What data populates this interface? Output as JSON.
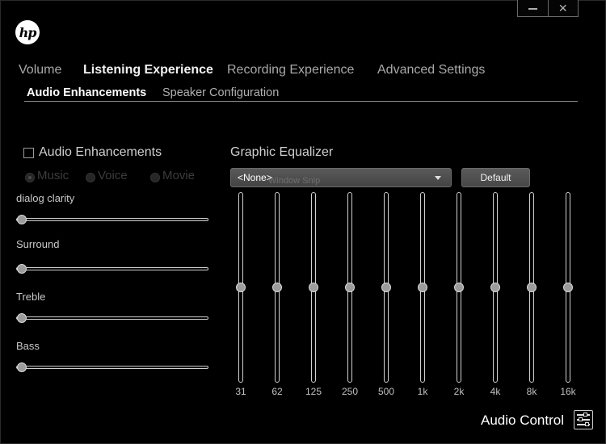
{
  "window": {
    "minimize_glyph": "",
    "close_glyph": "✕"
  },
  "brand": {
    "logo_text": "hp"
  },
  "main_tabs": [
    {
      "label": "Volume",
      "active": false
    },
    {
      "label": "Listening Experience",
      "active": true
    },
    {
      "label": "Recording Experience",
      "active": false
    },
    {
      "label": "Advanced Settings",
      "active": false
    }
  ],
  "sub_tabs": [
    {
      "label": "Audio Enhancements",
      "active": true
    },
    {
      "label": "Speaker Configuration",
      "active": false
    }
  ],
  "enhancements": {
    "checkbox_label": "Audio Enhancements",
    "checked": false,
    "modes": [
      {
        "label": "Music",
        "selected": true,
        "enabled": false
      },
      {
        "label": "Voice",
        "selected": false,
        "enabled": false
      },
      {
        "label": "Movie",
        "selected": false,
        "enabled": false
      }
    ]
  },
  "sliders": [
    {
      "label": "dialog clarity",
      "value_fraction": 0.0
    },
    {
      "label": "Surround",
      "value_fraction": 0.0
    },
    {
      "label": "Treble",
      "value_fraction": 0.0
    },
    {
      "label": "Bass",
      "value_fraction": 0.0
    }
  ],
  "equalizer": {
    "title": "Graphic Equalizer",
    "preset_value": "<None>",
    "overlay_text": "Window Snip",
    "default_button": "Default",
    "bands": [
      {
        "label": "31",
        "value_fraction": 0.5
      },
      {
        "label": "62",
        "value_fraction": 0.5
      },
      {
        "label": "125",
        "value_fraction": 0.5
      },
      {
        "label": "250",
        "value_fraction": 0.5
      },
      {
        "label": "500",
        "value_fraction": 0.5
      },
      {
        "label": "1k",
        "value_fraction": 0.5
      },
      {
        "label": "2k",
        "value_fraction": 0.5
      },
      {
        "label": "4k",
        "value_fraction": 0.5
      },
      {
        "label": "8k",
        "value_fraction": 0.5
      },
      {
        "label": "16k",
        "value_fraction": 0.5
      }
    ]
  },
  "footer": {
    "label": "Audio Control",
    "icon": "equalizer-settings-icon"
  },
  "colors": {
    "background": "#000000",
    "text_active": "#ffffff",
    "text_inactive": "#a8a8a8",
    "disabled": "#3c3c3c"
  }
}
